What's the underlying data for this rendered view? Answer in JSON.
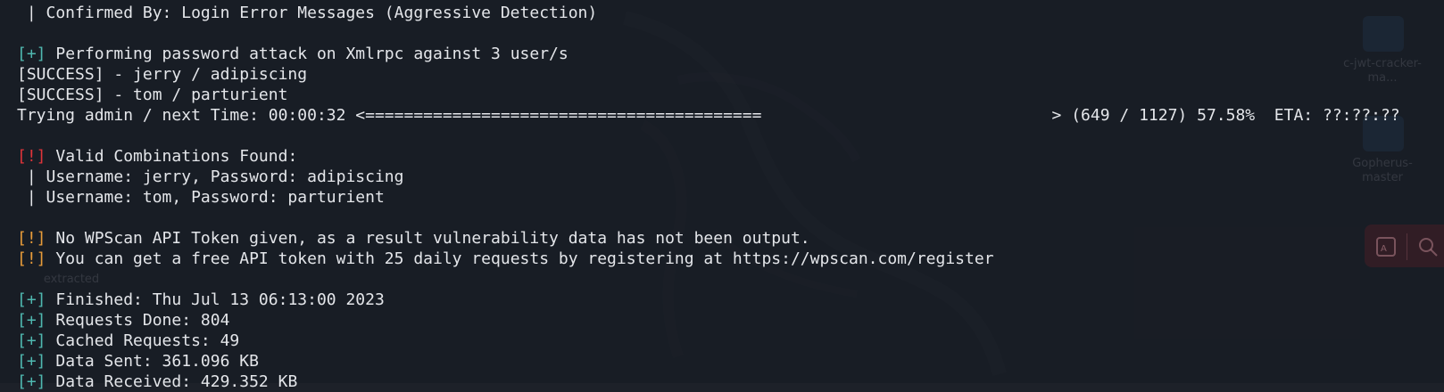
{
  "terminal": {
    "lines": [
      {
        "prefix": "",
        "text": " | Confirmed By: Login Error Messages (Aggressive Detection)"
      },
      {
        "prefix": "",
        "text": ""
      },
      {
        "prefix": "[+]",
        "text": " Performing password attack on Xmlrpc against 3 user/s"
      },
      {
        "prefix": "",
        "text": "[SUCCESS] - jerry / adipiscing"
      },
      {
        "prefix": "",
        "text": "[SUCCESS] - tom / parturient"
      },
      {
        "prefix": "",
        "text": "Trying admin / next Time: 00:00:32 <=========================================                              > (649 / 1127) 57.58%  ETA: ??:??:??"
      },
      {
        "prefix": "",
        "text": ""
      },
      {
        "prefix": "[!]",
        "text": " Valid Combinations Found:"
      },
      {
        "prefix": "",
        "text": " | Username: jerry, Password: adipiscing"
      },
      {
        "prefix": "",
        "text": " | Username: tom, Password: parturient"
      },
      {
        "prefix": "",
        "text": ""
      },
      {
        "prefix": "[!]",
        "text": " No WPScan API Token given, as a result vulnerability data has not been output."
      },
      {
        "prefix": "[!]",
        "text": " You can get a free API token with 25 daily requests by registering at https://wpscan.com/register"
      },
      {
        "prefix": "",
        "text": ""
      },
      {
        "prefix": "[+]",
        "text": " Finished: Thu Jul 13 06:13:00 2023"
      },
      {
        "prefix": "[+]",
        "text": " Requests Done: 804"
      },
      {
        "prefix": "[+]",
        "text": " Cached Requests: 49"
      },
      {
        "prefix": "[+]",
        "text": " Data Sent: 361.096 KB"
      },
      {
        "prefix": "[+]",
        "text": " Data Received: 429.352 KB"
      }
    ],
    "progress": {
      "done": 649,
      "total": 1127,
      "percent": 57.58
    }
  },
  "desktop": {
    "icons": [
      {
        "label": "c-jwt-cracker-ma..."
      },
      {
        "label": "Gopherus-master"
      },
      {
        "label": "extracted"
      }
    ]
  },
  "colors": {
    "plus": "#4fb8b0",
    "bang_error": "#e0343a",
    "bang_warn": "#e89c3a",
    "text": "#e4e6ea",
    "background": "#1d2129"
  }
}
